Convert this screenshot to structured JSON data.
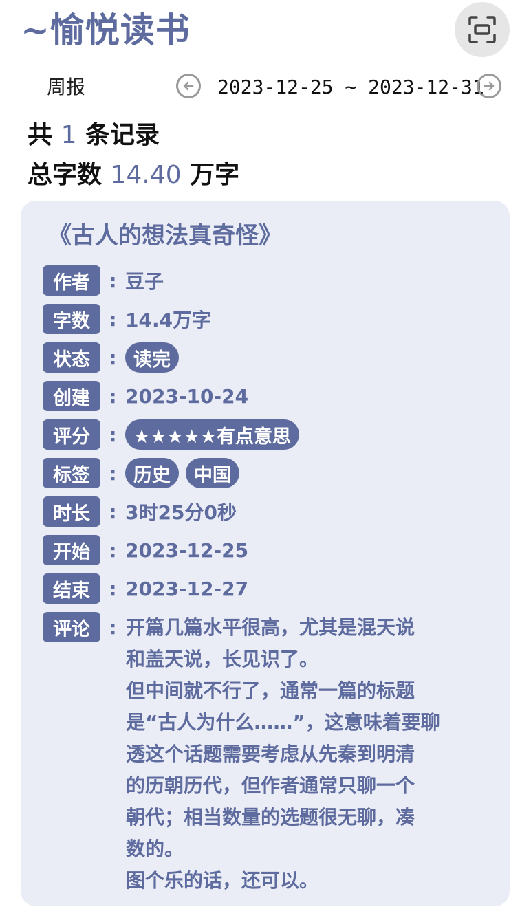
{
  "app": {
    "title": "~愉悦读书"
  },
  "period": {
    "label": "周报",
    "range": "2023-12-25 ~ 2023-12-31"
  },
  "summary": {
    "records_prefix": "共",
    "records_count": "1",
    "records_suffix": "条记录",
    "words_prefix": "总字数",
    "words_total": "14.40",
    "words_suffix": "万字"
  },
  "book": {
    "title": "《古人的想法真奇怪》",
    "author_label": "作者",
    "author": "豆子",
    "words_label": "字数",
    "words": "14.4万字",
    "status_label": "状态",
    "status": "读完",
    "created_label": "创建",
    "created": "2023-10-24",
    "rating_label": "评分",
    "rating": "★★★★★有点意思",
    "tags_label": "标签",
    "tags": [
      "历史",
      "中国"
    ],
    "duration_label": "时长",
    "duration": "3时25分0秒",
    "start_label": "开始",
    "start": "2023-12-25",
    "end_label": "结束",
    "end": "2023-12-27",
    "comment_label": "评论",
    "comment": "开篇几篇水平很高，尤其是混天说\n和盖天说，长见识了。\n但中间就不行了，通常一篇的标题\n是“古人为什么……”，这意味着要聊\n透这个话题需要考虑从先秦到明清\n的历朝历代，但作者通常只聊一个\n朝代；相当数量的选题很无聊，凑\n数的。\n图个乐的话，还可以。"
  },
  "colors": {
    "accent": "#5e6b9e",
    "card_bg": "#ebedf6"
  },
  "icons": {
    "scan": "scan-icon",
    "prev": "arrow-left-icon",
    "next": "arrow-right-icon"
  }
}
